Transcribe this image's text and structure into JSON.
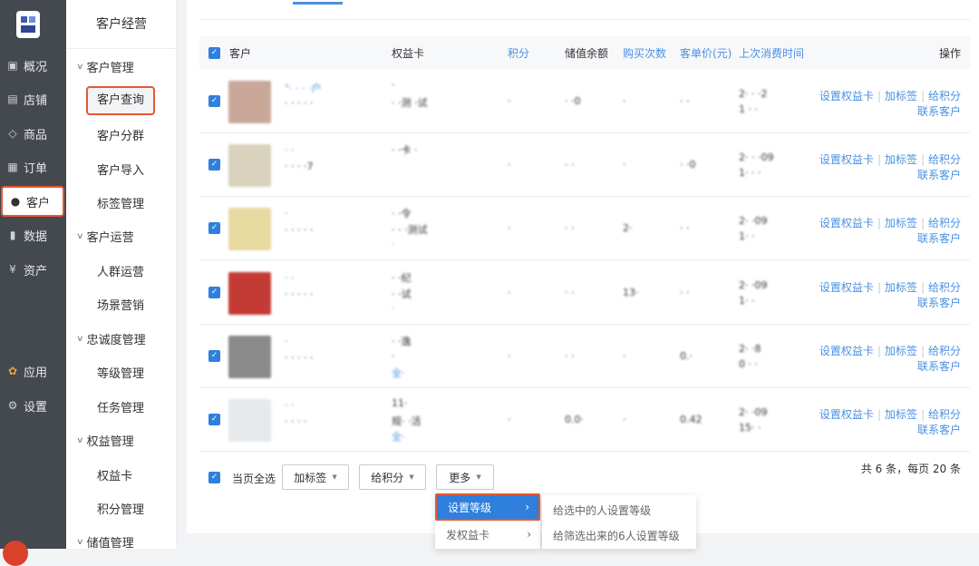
{
  "leftnav": {
    "items": [
      {
        "label": "概况",
        "icon": "dashboard-icon",
        "glyph": "▣"
      },
      {
        "label": "店铺",
        "icon": "store-icon",
        "glyph": "▤"
      },
      {
        "label": "商品",
        "icon": "tag-icon",
        "glyph": "◇"
      },
      {
        "label": "订单",
        "icon": "order-icon",
        "glyph": "▦"
      },
      {
        "label": "客户",
        "icon": "user-icon",
        "glyph": "●"
      },
      {
        "label": "数据",
        "icon": "chart-icon",
        "glyph": "▮"
      },
      {
        "label": "资产",
        "icon": "yen-icon",
        "glyph": "¥"
      },
      {
        "label": "应用",
        "icon": "apps-icon",
        "glyph": "✿"
      },
      {
        "label": "设置",
        "icon": "gear-icon",
        "glyph": "⚙"
      }
    ]
  },
  "subnav": {
    "title": "客户经营",
    "groups": [
      {
        "label": "客户管理",
        "items": [
          "客户查询",
          "客户分群",
          "客户导入",
          "标签管理"
        ]
      },
      {
        "label": "客户运营",
        "items": [
          "人群运营",
          "场景营销"
        ]
      },
      {
        "label": "忠诚度管理",
        "items": [
          "等级管理",
          "任务管理"
        ]
      },
      {
        "label": "权益管理",
        "items": [
          "权益卡",
          "积分管理"
        ]
      },
      {
        "label": "储值管理",
        "items": []
      }
    ]
  },
  "table": {
    "headers": {
      "customer": "客户",
      "card": "权益卡",
      "points": "积分",
      "balance": "储值余额",
      "purchases": "购买次数",
      "unit_price": "客单价(元)",
      "last_time": "上次消费时间",
      "ops": "操作"
    },
    "rows": [
      {
        "name": "\"·  ·  ·  ·户",
        "phone": "·  ·  ·  ·  ·",
        "card1": "·",
        "card2": "·  ·测  ·试",
        "card3": "",
        "points": "·",
        "balance": "·  ·0",
        "purchases": "·",
        "unit": "·  ·",
        "time1": "2·  ·  ·2",
        "time2": "1  ·  ·",
        "avatar": "#c9a89a"
      },
      {
        "name": "·  ·",
        "phone": "·  ·  ·  ·7",
        "card1": "·  ·卡  ·",
        "card2": "",
        "card3": "",
        "points": "·",
        "balance": "·  ·",
        "purchases": "·",
        "unit": "·  ·0",
        "time1": "2·  ·  ·09",
        "time2": "1·  ·  ·",
        "avatar": "#d9d2bd"
      },
      {
        "name": "·",
        "phone": "·  ·  ·  ·  ·",
        "card1": "·  ·令",
        "card2": "·  ·  ·测试",
        "card3": "·",
        "points": "·",
        "balance": "·  ·",
        "purchases": "2·",
        "unit": "·  ·",
        "time1": "2·  ·09",
        "time2": "1·  ·",
        "avatar": "#e8d9a0"
      },
      {
        "name": "·  ·",
        "phone": "·  ·  ·  ·  ·",
        "card1": "·  ·纪",
        "card2": "·  ·试",
        "card3": "·",
        "points": "·",
        "balance": "·  ·",
        "purchases": "13·",
        "unit": "·  ·",
        "time1": "2·  ·09",
        "time2": "1·  ·",
        "avatar": "#c43b35"
      },
      {
        "name": "·",
        "phone": "·  ·  ·  ·  ·",
        "card1": "·  ·逸",
        "card2": "·",
        "card3": "全·",
        "points": "·",
        "balance": "·  ·",
        "purchases": "·",
        "unit": "0.·",
        "time1": "2·  ·8",
        "time2": "0  ·  ·",
        "avatar": "#8a8a8a"
      },
      {
        "name": "·  ·",
        "phone": "·  ·  ·  ·",
        "card1": "11·",
        "card2": "规·  ·活",
        "card3": "全·",
        "points": "·",
        "balance": "0.0·",
        "purchases": "·",
        "unit": "0.42",
        "time1": "2·  ·09",
        "time2": "15·  ·",
        "avatar": "#e6e9ec"
      }
    ],
    "ops_labels": {
      "set_card": "设置权益卡",
      "add_tag": "加标签",
      "give_points": "给积分",
      "contact": "联系客户"
    }
  },
  "footer": {
    "select_all": "当页全选",
    "add_tag": "加标签",
    "give_points": "给积分",
    "more": "更多",
    "pager": "共 6 条，每页 20 条"
  },
  "more_menu": {
    "items": [
      "设置等级",
      "发权益卡"
    ],
    "submenu": [
      "给选中的人设置等级",
      "给筛选出来的6人设置等级"
    ]
  },
  "colors": {
    "accent": "#2f7fdc",
    "link": "#4a90e2",
    "highlight_border": "#e8572f",
    "nav_bg": "#444950"
  }
}
